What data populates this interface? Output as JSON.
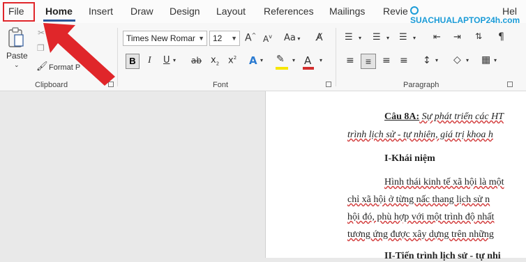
{
  "tabs": [
    {
      "label": "File"
    },
    {
      "label": "Home"
    },
    {
      "label": "Insert"
    },
    {
      "label": "Draw"
    },
    {
      "label": "Design"
    },
    {
      "label": "Layout"
    },
    {
      "label": "References"
    },
    {
      "label": "Mailings"
    },
    {
      "label": "Revie"
    },
    {
      "label": "Hel"
    }
  ],
  "watermark": "SUACHUALAPTOP24h.com",
  "clipboard": {
    "paste_label": "Paste",
    "format_painter_label": "Format P",
    "group_label": "Clipboard"
  },
  "font": {
    "font_name": "Times New Romar",
    "font_size": "12",
    "group_label": "Font",
    "bold": "B",
    "italic": "I",
    "underline": "U",
    "strike": "ab",
    "subscript": "x",
    "superscript": "x",
    "grow": "A",
    "shrink": "A",
    "case": "Aa",
    "effects": "A",
    "font_color": "A"
  },
  "paragraph": {
    "group_label": "Paragraph",
    "pilcrow": "¶"
  },
  "document": {
    "line1_a": "Câu 8A:",
    "line1_b": " Sự phát triển các HT",
    "line2": "trình lịch sử - tự nhiên, giá trị khoa h",
    "line3": "I-Khái niệm",
    "line4": "Hình thái kinh tế xã hội là một",
    "line5": "chỉ xã hội ở từng nấc thang lịch sử n",
    "line6": "hội đó, phù hợp với một trình độ nhất",
    "line7": "tương ứng được xây dựng trên những",
    "line8": "II-Tiến trình lịch sử - tự nhi"
  },
  "colors": {
    "accent": "#2b579a",
    "highlight": "#f7e600",
    "font_color": "#d32f2f",
    "annotation": "#e0262a"
  }
}
